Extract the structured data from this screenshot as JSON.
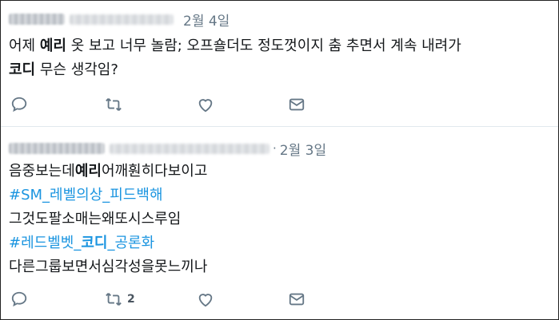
{
  "tweets": [
    {
      "date": "2월 4일",
      "lines": [
        [
          {
            "t": "어제 ",
            "b": false
          },
          {
            "t": "예리",
            "b": true
          },
          {
            "t": " 옷 보고 너무 놀람; 오프숄더도 정도껏이지 춤 추면서 계속 내려가",
            "b": false
          }
        ],
        [
          {
            "t": "코디",
            "b": true
          },
          {
            "t": " 무슨 생각임?",
            "b": false
          }
        ]
      ],
      "actions": {
        "reply_icon": "reply-icon",
        "retweet_icon": "retweet-icon",
        "retweet_count": "",
        "like_icon": "heart-icon",
        "dm_icon": "envelope-icon"
      }
    },
    {
      "date": "2월 3일",
      "lines": [
        [
          {
            "t": "음중보는데",
            "b": false
          },
          {
            "t": "예리",
            "b": true
          },
          {
            "t": "어깨훤히다보이고",
            "b": false
          }
        ],
        [
          {
            "t": "#SM_레벨의상_피드백해",
            "tag": true
          }
        ],
        [
          {
            "t": "그것도팔소매는왜또시스루임",
            "b": false
          }
        ],
        [
          {
            "t": "#레드벨벳_",
            "tag": true
          },
          {
            "t": "코디",
            "tag": true,
            "b": true
          },
          {
            "t": "_공론화",
            "tag": true
          }
        ],
        [
          {
            "t": "다른그룹보면서심각성을못느끼나",
            "b": false
          }
        ]
      ],
      "actions": {
        "reply_icon": "reply-icon",
        "retweet_icon": "retweet-icon",
        "retweet_count": "2",
        "like_icon": "heart-icon",
        "dm_icon": "envelope-icon"
      }
    }
  ]
}
